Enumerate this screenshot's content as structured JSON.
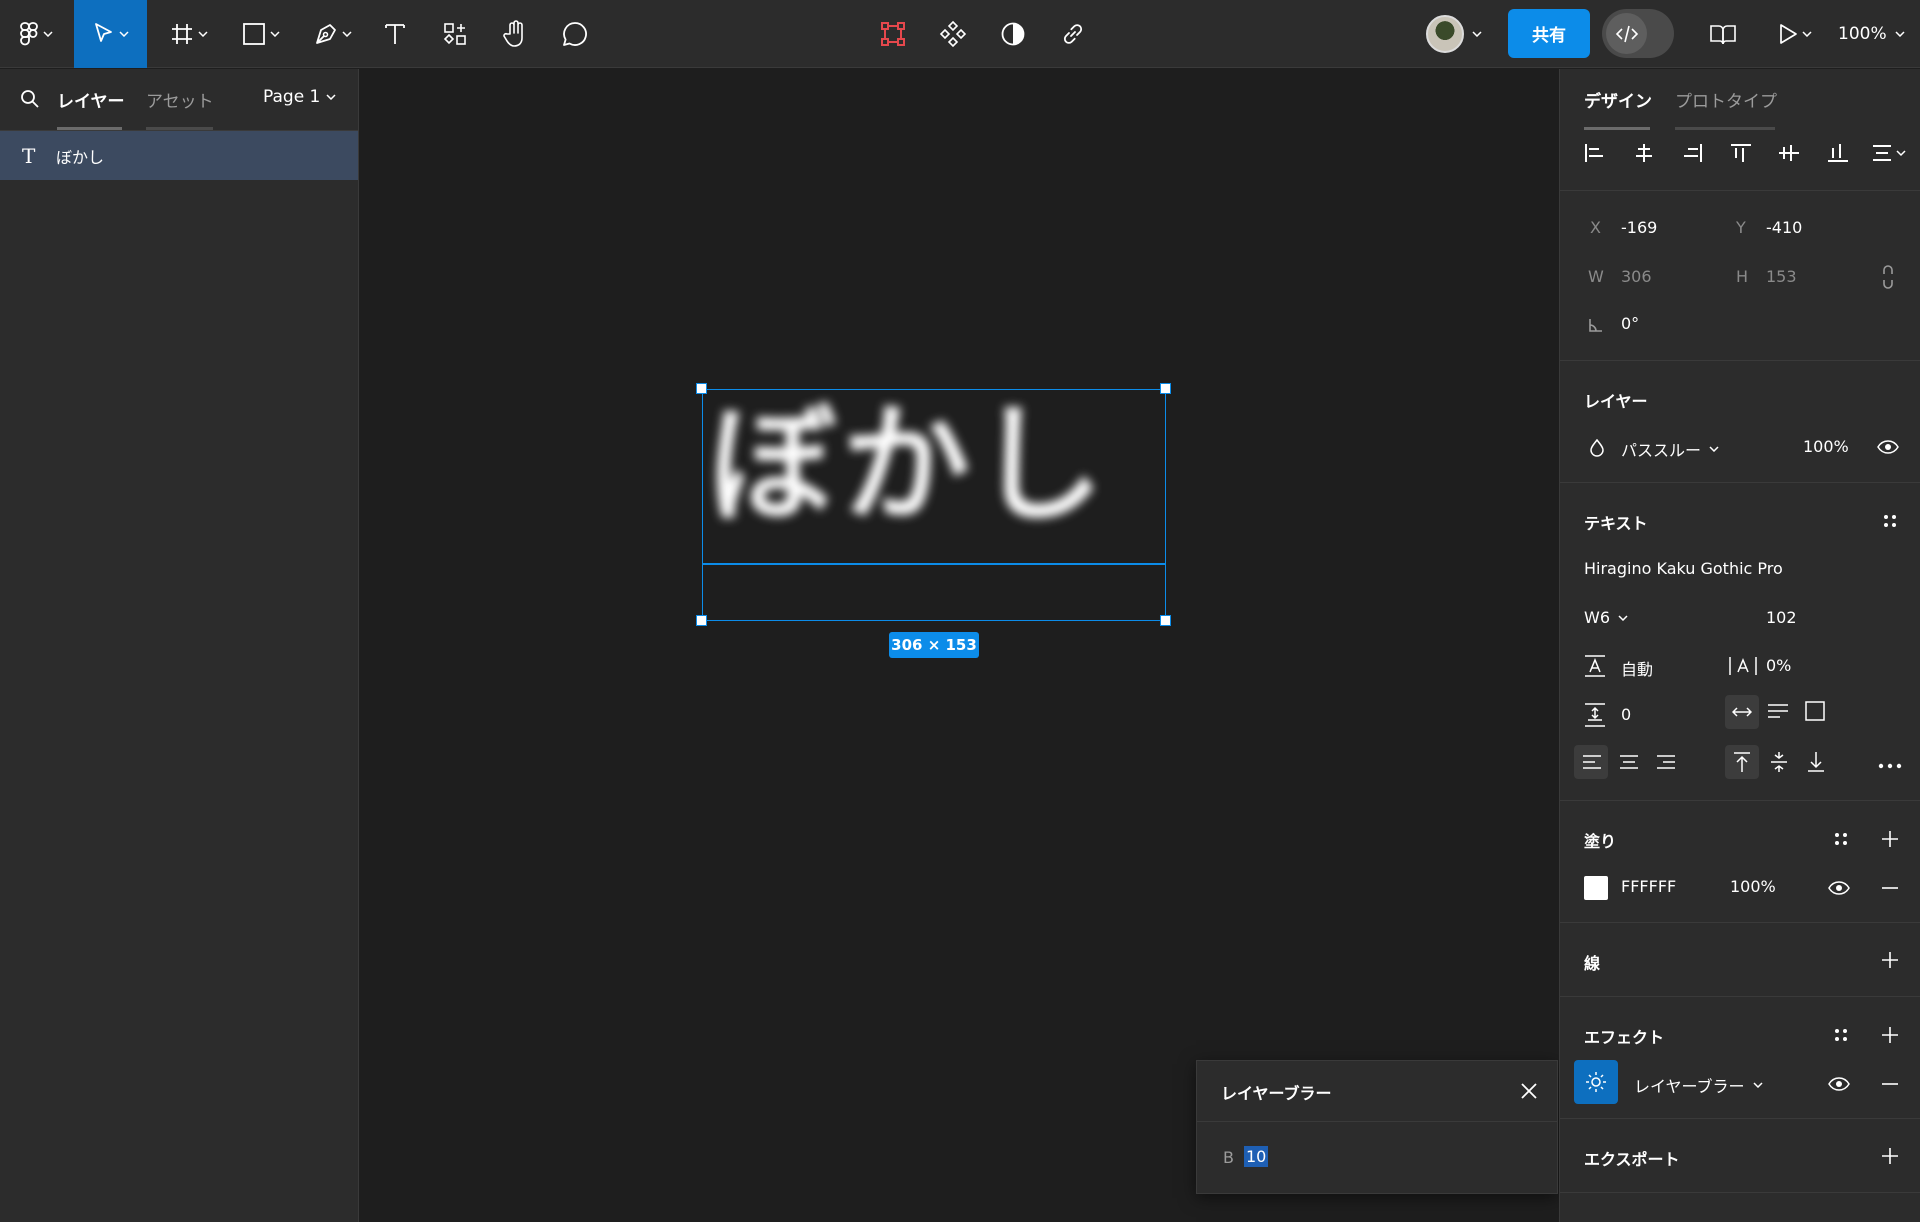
{
  "toolbar": {
    "share_label": "共有",
    "zoom": "100%"
  },
  "left_panel": {
    "tabs": [
      {
        "label": "レイヤー",
        "active": true
      },
      {
        "label": "アセット",
        "active": false
      }
    ],
    "page_select": "Page 1",
    "layers": [
      {
        "name": "ぼかし",
        "type": "text"
      }
    ]
  },
  "canvas": {
    "text_content": "ぼかし",
    "dimension_badge": "306 × 153"
  },
  "blur_popup": {
    "title": "レイヤーブラー",
    "field_label": "B",
    "field_value": "10"
  },
  "right_panel": {
    "tabs": [
      {
        "label": "デザイン",
        "active": true
      },
      {
        "label": "プロトタイプ",
        "active": false
      }
    ],
    "position": {
      "x_label": "X",
      "x": "-169",
      "y_label": "Y",
      "y": "-410",
      "w_label": "W",
      "w": "306",
      "h_label": "H",
      "h": "153",
      "rotation": "0°"
    },
    "layer": {
      "title": "レイヤー",
      "blend_mode": "パススルー",
      "opacity": "100%"
    },
    "text": {
      "title": "テキスト",
      "font_family": "Hiragino Kaku Gothic Pro",
      "font_weight": "W6",
      "font_size": "102",
      "line_height": "自動",
      "letter_spacing": "0%",
      "paragraph_spacing": "0"
    },
    "fill": {
      "title": "塗り",
      "hex": "FFFFFF",
      "opacity": "100%",
      "color": "#ffffff"
    },
    "stroke": {
      "title": "線"
    },
    "effects": {
      "title": "エフェクト",
      "effect_name": "レイヤーブラー"
    },
    "export": {
      "title": "エクスポート"
    }
  },
  "colors": {
    "accent": "#0c8ce9",
    "panel_bg": "#2c2c2c",
    "canvas_bg": "#1e1e1e",
    "selection_row": "#3c4a60",
    "design_red_icon": "#e5484d"
  }
}
